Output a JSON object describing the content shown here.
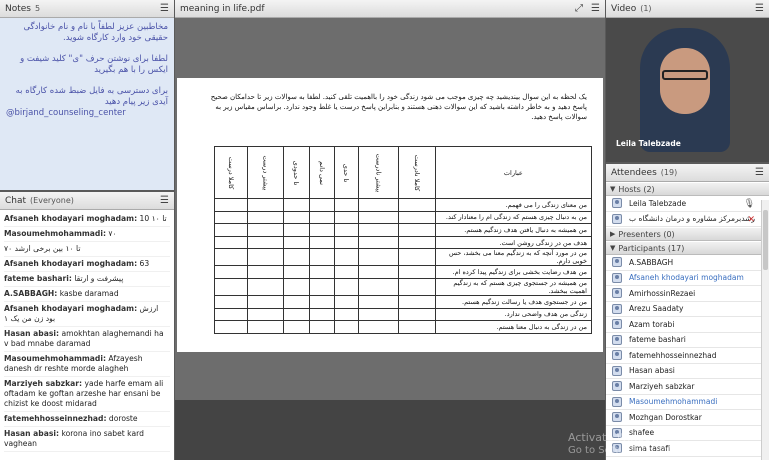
{
  "notes": {
    "title": "Notes",
    "count": "5",
    "lines": [
      "مخاطبین عزیز لطفاً با نام و نام خانوادگی حقیقی خود وارد کارگاه شوید.",
      "لطفا برای نوشتن حرف \"ی\" کلید شیفت و ایکس را با هم بگیرید",
      "برای دسترسی به فایل ضبط شده کارگاه به آیدی زیر پیام دهید"
    ],
    "handle": "@birjand_counseling_center"
  },
  "chat": {
    "title": "Chat",
    "scope": "(Everyone)",
    "messages": [
      {
        "sender": "Afsaneh khodayari moghadam:",
        "text": "10 ۱۰ تا"
      },
      {
        "sender": "Masoumehmohammadi:",
        "text": "۷۰"
      },
      {
        "sender": "",
        "text": "۷۰ تا ۱۰ بین برخی ارشد"
      },
      {
        "sender": "Afsaneh khodayari moghadam:",
        "text": "63"
      },
      {
        "sender": "fateme bashari:",
        "text": "پیشرفت و ارتقا"
      },
      {
        "sender": "A.SABBAGH:",
        "text": "kasbe daramad"
      },
      {
        "sender": "Afsaneh khodayari moghadam:",
        "text": "ارزش بود زن من یک ۱"
      },
      {
        "sender": "Hasan abasi:",
        "text": "amokhtan alaghemandi ha v bad mnabe daramad"
      },
      {
        "sender": "Masoumehmohammadi:",
        "text": "Afzayesh danesh dr reshte morde alagheh"
      },
      {
        "sender": "Marziyeh sabzkar:",
        "text": "yade harfe emam ali oftadam ke goftan arzeshe har ensani be chizist ke doost midarad"
      },
      {
        "sender": "fatemehhosseinnezhad:",
        "text": "doroste"
      },
      {
        "sender": "Hasan abasi:",
        "text": "korona ino sabet kard vaghean"
      }
    ]
  },
  "doc": {
    "title": "meaning in life.pdf",
    "intro": "یک لحظه به این سوال بیندیشید چه چیزی موجب می شود زندگی خود را بااهمیت تلقی کنید. لطفا به سوالات زیر تا حدامکان صحیح پاسخ دهید و به خاطر داشته باشید که این سوالات ذهنی هستند و بنابراین پاسخ درست یا غلط وجود ندارد. براساس مقیاس زیر به سوالات پاسخ دهید.",
    "table_header": "عبارات",
    "columns": [
      "کاملا نادرست",
      "بیشتر نادرست",
      "تا حدی",
      "نمی دانم",
      "تا حدودی",
      "بیشتر درست",
      "کاملا درست"
    ],
    "statements": [
      "من معنای زندگی را می فهمم.",
      "من به دنبال چیزی هستم که زندگی ام را معنادار کند.",
      "من همیشه به دنبال یافتن هدف زندگیم هستم.",
      "هدف من در زندگی روشن است.",
      "من در مورد آنچه که به زندگیم معنا می بخشد، حس خوبی دارم.",
      "من هدف رضایت بخشی برای زندگیم پیدا کرده ام.",
      "من همیشه در جستجوی چیزی هستم که به زندگیم اهمیت ببخشد.",
      "من در جستجوی هدف یا رسالت زندگیم هستم.",
      "زندگی من هدف واضحی ندارد.",
      "من در زندگی به دنبال معنا هستم."
    ]
  },
  "video": {
    "title": "Video",
    "count": "(1)",
    "presenter": "Leila Talebzade"
  },
  "attendees": {
    "title": "Attendees",
    "count": "(19)",
    "hosts_label": "Hosts (2)",
    "hosts": [
      "Leila Talebzade",
      "رشدبرمرکز مشاوره و درمان دانشگاه ب"
    ],
    "presenters_label": "Presenters (0)",
    "participants_label": "Participants (17)",
    "participants": [
      {
        "name": "A.SABBAGH",
        "hl": false
      },
      {
        "name": "Afsaneh khodayari moghadam",
        "hl": true
      },
      {
        "name": "AmirhossinRezaei",
        "hl": false
      },
      {
        "name": "Arezu Saadaty",
        "hl": false
      },
      {
        "name": "Azam torabi",
        "hl": false
      },
      {
        "name": "fateme bashari",
        "hl": false
      },
      {
        "name": "fatemehhosseinnezhad",
        "hl": false
      },
      {
        "name": "Hasan abasi",
        "hl": false
      },
      {
        "name": "Marziyeh sabzkar",
        "hl": false
      },
      {
        "name": "Masoumehmohammadi",
        "hl": true
      },
      {
        "name": "Mozhgan Dorostkar",
        "hl": false
      },
      {
        "name": "shafee",
        "hl": false
      },
      {
        "name": "sima tasafi",
        "hl": false
      }
    ]
  },
  "watermark": {
    "line1": "Activate Windows",
    "line2": "Go to Settings to activate Windows."
  }
}
